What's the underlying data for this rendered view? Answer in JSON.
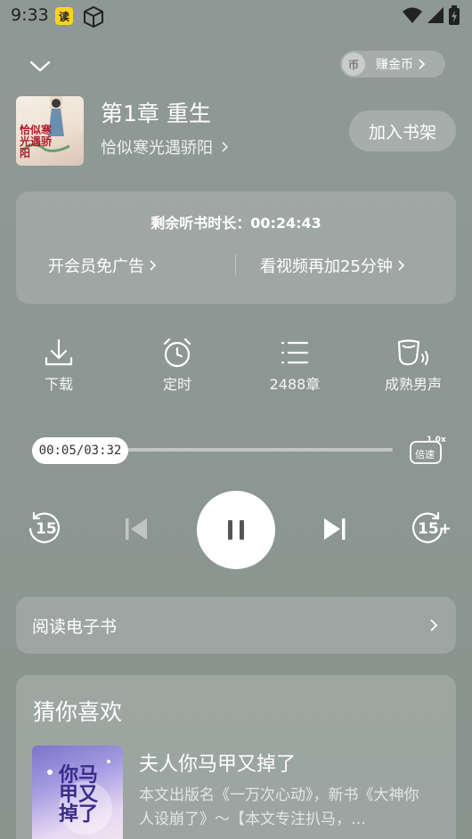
{
  "status_bar": {
    "time": "9:33",
    "app_badge": "读"
  },
  "header": {
    "earn_coins_label": "赚金币",
    "coin_glyph": "币",
    "chapter_title": "第1章 重生",
    "book_title": "恰似寒光遇骄阳",
    "add_shelf_label": "加入书架",
    "cover_text": "恰似寒光遇骄阳"
  },
  "time_card": {
    "remaining_label": "剩余听书时长：",
    "remaining_value": "00:24:43",
    "vip_label": "开会员免广告",
    "video_label": "看视频再加25分钟"
  },
  "actions": [
    {
      "label": "下载",
      "icon": "download-icon"
    },
    {
      "label": "定时",
      "icon": "alarm-clock-icon"
    },
    {
      "label": "2488章",
      "icon": "list-icon"
    },
    {
      "label": "成熟男声",
      "icon": "voice-icon"
    }
  ],
  "progress": {
    "current": "00:05",
    "total": "03:32",
    "display": "00:05/03:32",
    "speed_value": "1.0x",
    "speed_label": "倍速"
  },
  "controls": {
    "rewind": "15",
    "forward": "15+"
  },
  "ebook": {
    "label": "阅读电子书"
  },
  "recommend": {
    "title": "猜你喜欢",
    "book_title": "夫人你马甲又掉了",
    "desc": "本文出版名《一万次心动》，新书《大神你人设崩了》〜【本文专注扒马，…",
    "cover_text": "你马甲又掉了"
  }
}
